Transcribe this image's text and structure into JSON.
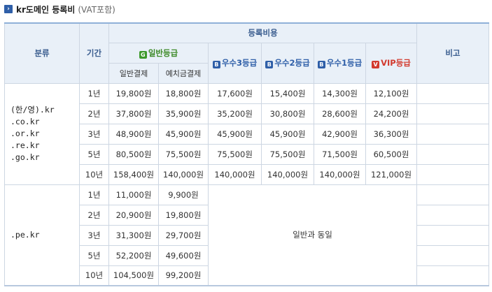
{
  "title": {
    "main": "kr도메인 등록비",
    "sub": "(VAT포함)"
  },
  "colors": {
    "header_bg": "#e9f0f8",
    "header_text": "#3a5d8f",
    "grade_green": "#3d8a28",
    "grade_blue": "#2f5fa8",
    "grade_red": "#d23a2e"
  },
  "header": {
    "category": "분류",
    "period": "기간",
    "fee": "등록비용",
    "note": "비고",
    "general": {
      "badge": "G",
      "label": "일반등급"
    },
    "general_sub": {
      "normal": "일반결제",
      "deposit": "예치금결제"
    },
    "excellent3": {
      "badge": "B",
      "label": "우수3등급"
    },
    "excellent2": {
      "badge": "B",
      "label": "우수2등급"
    },
    "excellent1": {
      "badge": "B",
      "label": "우수1등급"
    },
    "vip": {
      "badge": "V",
      "label": "VIP등급"
    }
  },
  "groups": [
    {
      "domains": [
        "(한/영).kr",
        ".co.kr",
        ".or.kr",
        ".re.kr",
        ".go.kr"
      ],
      "rows": [
        {
          "period": "1년",
          "normal": "19,800원",
          "deposit": "18,800원",
          "ex3": "17,600원",
          "ex2": "15,400원",
          "ex1": "14,300원",
          "vip": "12,100원",
          "note": ""
        },
        {
          "period": "2년",
          "normal": "37,800원",
          "deposit": "35,900원",
          "ex3": "35,200원",
          "ex2": "30,800원",
          "ex1": "28,600원",
          "vip": "24,200원",
          "note": ""
        },
        {
          "period": "3년",
          "normal": "48,900원",
          "deposit": "45,900원",
          "ex3": "45,900원",
          "ex2": "45,900원",
          "ex1": "42,900원",
          "vip": "36,300원",
          "note": ""
        },
        {
          "period": "5년",
          "normal": "80,500원",
          "deposit": "75,500원",
          "ex3": "75,500원",
          "ex2": "75,500원",
          "ex1": "71,500원",
          "vip": "60,500원",
          "note": ""
        },
        {
          "period": "10년",
          "normal": "158,400원",
          "deposit": "140,000원",
          "ex3": "140,000원",
          "ex2": "140,000원",
          "ex1": "140,000원",
          "vip": "121,000원",
          "note": ""
        }
      ]
    },
    {
      "domains": [
        ".pe.kr"
      ],
      "same_as_general": "일반과 동일",
      "rows": [
        {
          "period": "1년",
          "normal": "11,000원",
          "deposit": "9,900원",
          "note": ""
        },
        {
          "period": "2년",
          "normal": "20,900원",
          "deposit": "19,800원",
          "note": ""
        },
        {
          "period": "3년",
          "normal": "31,300원",
          "deposit": "29,700원",
          "note": ""
        },
        {
          "period": "5년",
          "normal": "52,200원",
          "deposit": "49,600원",
          "note": ""
        },
        {
          "period": "10년",
          "normal": "104,500원",
          "deposit": "99,200원",
          "note": ""
        }
      ]
    }
  ]
}
